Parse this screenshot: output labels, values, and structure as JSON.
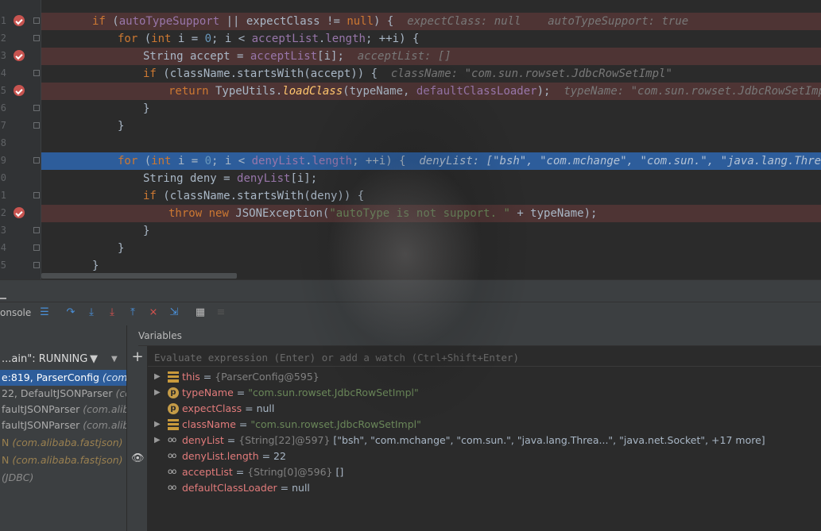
{
  "editor": {
    "gutter_numbers": [
      "1",
      "2",
      "3",
      "4",
      "5",
      "6",
      "7",
      "8",
      "9",
      "0",
      "1",
      "2",
      "3",
      "4",
      "5"
    ],
    "code": {
      "line1": {
        "kw1": "if",
        "p1": " (",
        "f1": "autoTypeSupport",
        "p2": " || expectClass != ",
        "kw2": "null",
        "p3": ") {",
        "hint": "expectClass: null    autoTypeSupport: true"
      },
      "line2": {
        "kw1": "for",
        "p1": " (",
        "kw2": "int",
        "p2": " i = ",
        "n1": "0",
        "p3": "; i < ",
        "f1": "acceptList",
        "p4": ".",
        "f2": "length",
        "p5": "; ++i) {"
      },
      "line3": {
        "p1": "String accept = ",
        "f1": "acceptList",
        "p2": "[i];",
        "hint": "acceptList: []"
      },
      "line4": {
        "kw1": "if",
        "p1": " (className.startsWith(accept)) {",
        "hint": "className: \"com.sun.rowset.JdbcRowSetImpl\""
      },
      "line5": {
        "kw1": "return",
        "p1": " TypeUtils.",
        "fn": "loadClass",
        "p2": "(typeName, ",
        "f1": "defaultClassLoader",
        "p3": ");",
        "hint": "typeName: \"com.sun.rowset.JdbcRowSetImpl\""
      },
      "line6": {
        "p1": "}"
      },
      "line7": {
        "p1": "}"
      },
      "line9": {
        "kw1": "for",
        "p1": " (",
        "kw2": "int",
        "p2": " i = ",
        "n1": "0",
        "p3": "; i < ",
        "f1": "denyList",
        "p4": ".",
        "f2": "length",
        "p5": "; ++i) {",
        "hint": "denyList: [\"bsh\", \"com.mchange\", \"com.sun.\", \"java.lang.Threa...\""
      },
      "line10": {
        "p1": "String deny = ",
        "f1": "denyList",
        "p2": "[i];"
      },
      "line11": {
        "kw1": "if",
        "p1": " (className.startsWith(deny)) {"
      },
      "line12": {
        "kw1": "throw",
        "kw2": " new",
        "p1": " JSONException(",
        "s1": "\"autoType is not support. \"",
        "p2": " + typeName);"
      },
      "line13": {
        "p1": "}"
      },
      "line14": {
        "p1": "}"
      },
      "line15": {
        "p1": "}"
      }
    }
  },
  "toolbar": {
    "console_tab": "onsole"
  },
  "frames": {
    "thread_label": "...ain\": RUNNING",
    "items": [
      {
        "method": "e:819, ParserConfig ",
        "pkg": "(com.ali"
      },
      {
        "method": "22, DefaultJSONParser ",
        "pkg": "(com"
      },
      {
        "method": "faultJSONParser ",
        "pkg": "(com.aliba"
      },
      {
        "method": "faultJSONParser ",
        "pkg": "(com.aliba"
      },
      {
        "method": "N ",
        "pkg": "(com.alibaba.fastjson)"
      },
      {
        "method": "N ",
        "pkg": "(com.alibaba.fastjson)"
      },
      {
        "method": "",
        "pkg": "(JDBC)"
      }
    ]
  },
  "variables": {
    "title": "Variables",
    "eval_placeholder": "Evaluate expression (Enter) or add a watch (Ctrl+Shift+Enter)",
    "rows": [
      {
        "name": "this",
        "eq": " = ",
        "val": "{ParserConfig@595}"
      },
      {
        "name": "typeName",
        "eq": " = ",
        "val": "\"com.sun.rowset.JdbcRowSetImpl\""
      },
      {
        "name": "expectClass",
        "eq": " = ",
        "val": "null"
      },
      {
        "name": "className",
        "eq": " = ",
        "val": "\"com.sun.rowset.JdbcRowSetImpl\""
      },
      {
        "name": "denyList",
        "eq": " = ",
        "val": "{String[22]@597}",
        "extra": " [\"bsh\", \"com.mchange\", \"com.sun.\", \"java.lang.Threa...\", \"java.net.Socket\", +17 more]"
      },
      {
        "name": "denyList.length",
        "eq": " = ",
        "val": "22"
      },
      {
        "name": "acceptList",
        "eq": " = ",
        "val": "{String[0]@596}",
        "extra": " []"
      },
      {
        "name": "defaultClassLoader",
        "eq": " = ",
        "val": "null"
      }
    ]
  },
  "colors": {
    "breakpoint": "#c75450",
    "current_line": "#2d5d9b",
    "keyword": "#cc7832",
    "field": "#9876aa",
    "string": "#6a8759"
  }
}
